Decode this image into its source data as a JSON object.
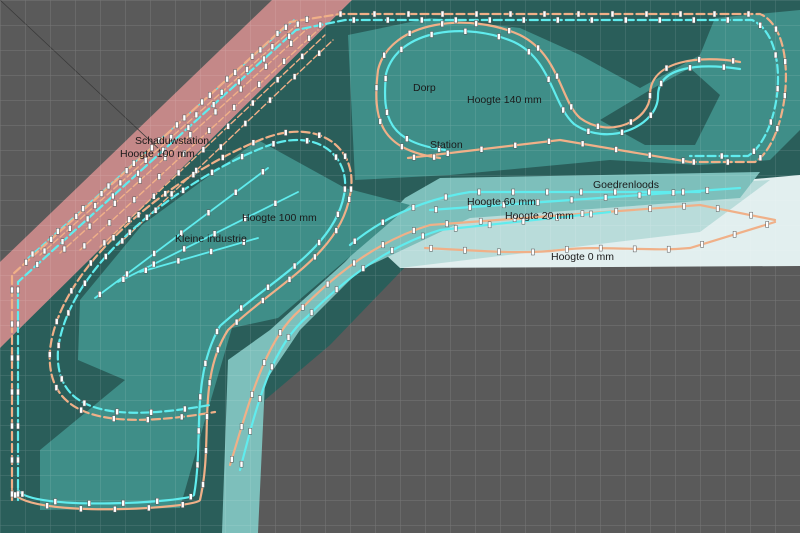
{
  "labels": {
    "schaduwstation": "Schaduwstation",
    "hoogte_100_a": "Hoogte 100 mm",
    "dorp": "Dorp",
    "hoogte_140": "Hoogte 140 mm",
    "station": "Station",
    "goederenloods": "Goedrenloods",
    "hoogte_60": "Hoogte 60 mm",
    "hoogte_20": "Hoogte 20 mm",
    "hoogte_100_b": "Hoogte 100 mm",
    "kleine_industrie": "Kleine industrie",
    "hoogte_0": "Hoogte 0 mm"
  },
  "colors": {
    "background": "#5a5a5a",
    "board_dark": "#2a5e5a",
    "board_mid": "#3f8e88",
    "board_light": "#7dbfbb",
    "board_pale": "#b9dcda",
    "board_white": "#e2efef",
    "shadow_station": "#c48888",
    "track_orange": "#f0b088",
    "track_cyan": "#60ecee"
  }
}
